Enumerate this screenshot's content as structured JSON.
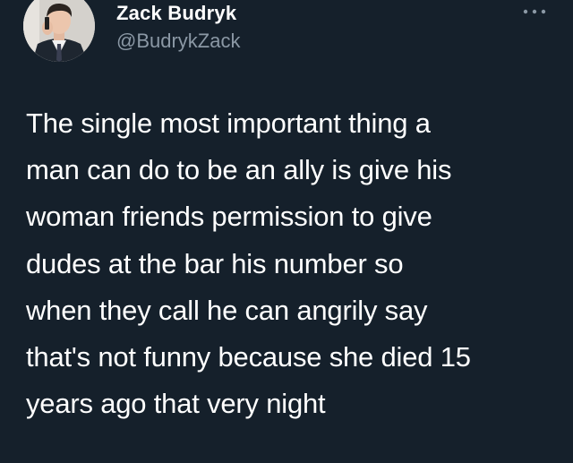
{
  "author": {
    "display_name": "Zack Budryk",
    "handle": "@BudrykZack",
    "avatar_icon": "profile-photo-avatar"
  },
  "menu": {
    "icon": "more-horizontal-icon"
  },
  "tweet": {
    "text": "The single most important thing a\nman can do to be an ally is give his\nwoman friends permission to give\ndudes at the bar his number so\nwhen they call he can angrily say\nthat's not funny because she died 15\nyears ago that very night"
  },
  "colors": {
    "background": "#15202b",
    "primary_text": "#ffffff",
    "secondary_text": "#8b98a5"
  }
}
